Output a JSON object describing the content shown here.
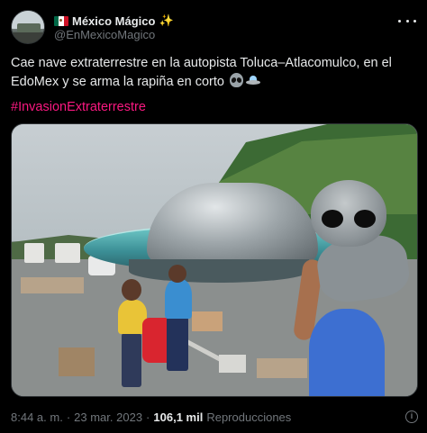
{
  "author": {
    "display_name": "México Mágico",
    "sparkle_emoji": "✨",
    "handle": "@EnMexicoMagico",
    "flag_icon": "mexico-flag-icon",
    "verified": false
  },
  "tweet": {
    "text": "Cae nave extraterrestre en la autopista Toluca–Atlacomulco, en el EdoMex y se arma la rapiña en corto",
    "emojis": [
      "alien-emoji",
      "flying-saucer-emoji"
    ],
    "hashtag": "#InvasionExtraterrestre",
    "hashtag_color": "#f91880"
  },
  "media": {
    "type": "photo",
    "subject": [
      "flying-saucer",
      "alien-figure",
      "highway",
      "crowd",
      "scattered-cargo"
    ]
  },
  "footer": {
    "time": "8:44 a. m.",
    "separator": "·",
    "date": "23 mar. 2023",
    "views_count": "106,1 mil",
    "views_label": "Reproducciones"
  },
  "colors": {
    "background": "#000000",
    "text_primary": "#e7e9ea",
    "text_secondary": "#71767b",
    "hashtag": "#f91880"
  }
}
